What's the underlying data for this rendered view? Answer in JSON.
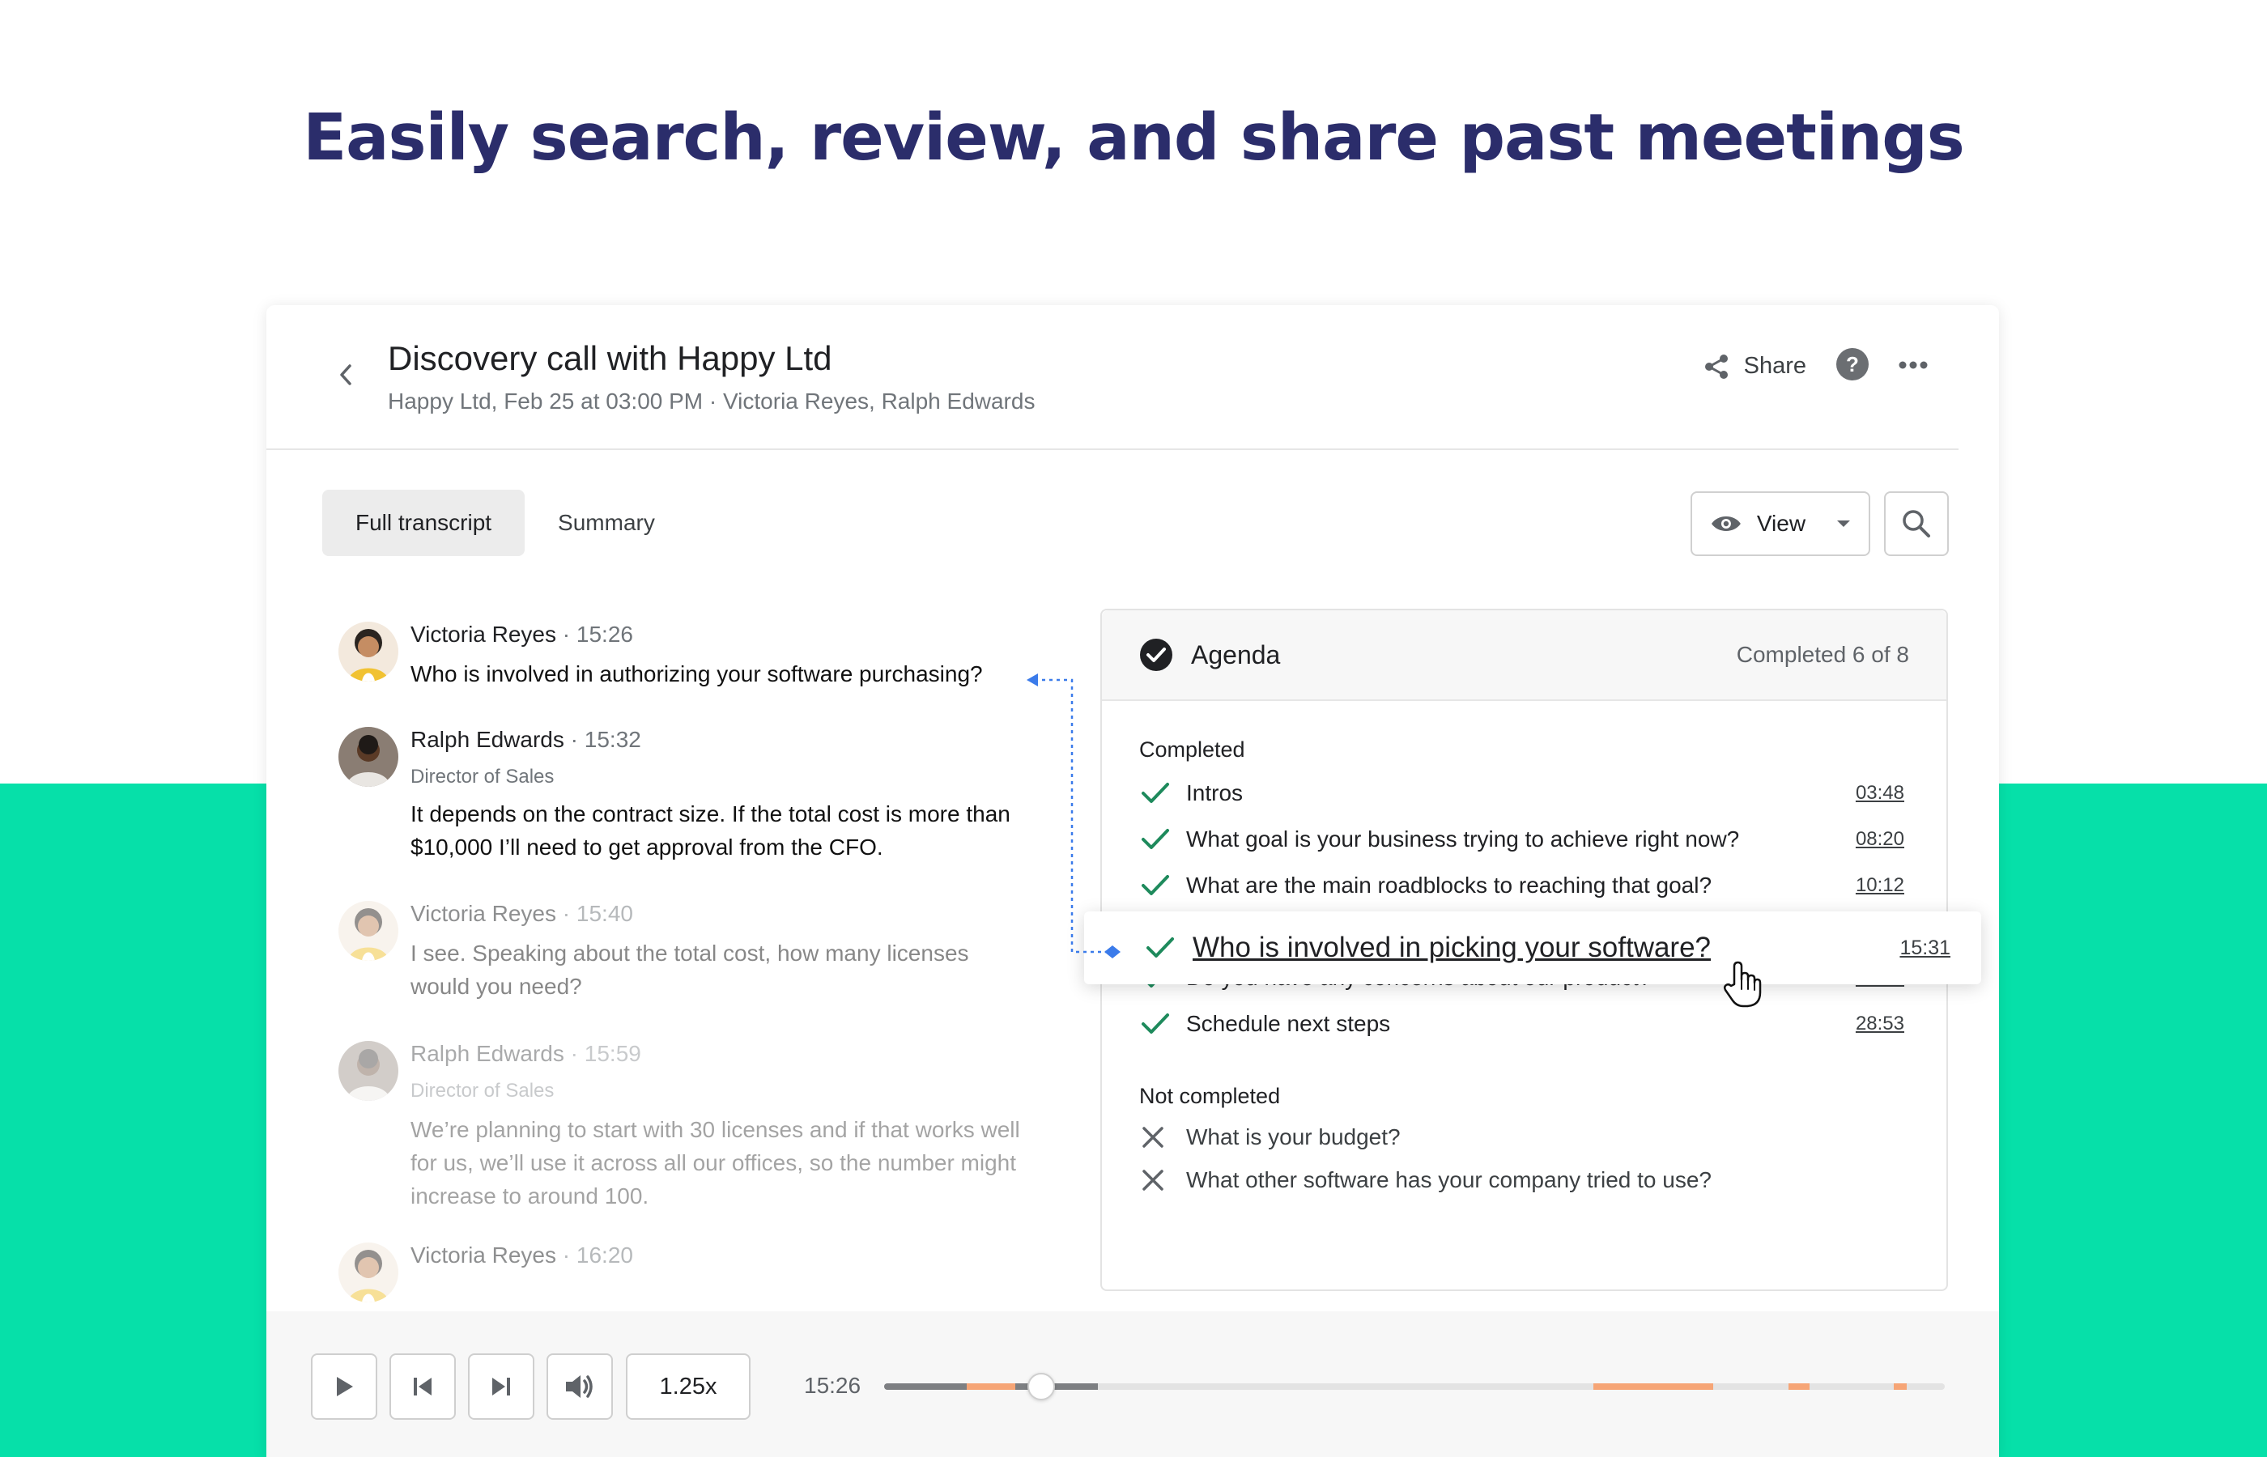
{
  "headline": "Easily search, review, and share past meetings",
  "header": {
    "title": "Discovery call with Happy Ltd",
    "subtitle": "Happy Ltd, Feb 25 at 03:00 PM · Victoria Reyes, Ralph Edwards",
    "share_label": "Share"
  },
  "tabs": [
    {
      "label": "Full transcript",
      "active": true
    },
    {
      "label": "Summary",
      "active": false
    }
  ],
  "toolbar": {
    "view_label": "View"
  },
  "transcript": [
    {
      "speaker": "Victoria Reyes",
      "time": "15:26",
      "role": "",
      "text": "Who is involved in authorizing your software purchasing?"
    },
    {
      "speaker": "Ralph Edwards",
      "time": "15:32",
      "role": "Director of Sales",
      "text": "It depends on the contract size. If the total cost is more than $10,000 I’ll need to get approval from the CFO."
    },
    {
      "speaker": "Victoria Reyes",
      "time": "15:40",
      "role": "",
      "text": "I see. Speaking about the total cost, how many licenses would you need?"
    },
    {
      "speaker": "Ralph Edwards",
      "time": "15:59",
      "role": "Director of Sales",
      "text": "We’re planning to start with 30 licenses and if that works well for us, we’ll use it across all our offices, so the number might increase to around 100."
    },
    {
      "speaker": "Victoria Reyes",
      "time": "16:20",
      "role": "",
      "text": ""
    }
  ],
  "agenda": {
    "title": "Agenda",
    "count": "Completed 6 of 8",
    "completed_heading": "Completed",
    "not_completed_heading": "Not completed",
    "completed": [
      {
        "label": "Intros",
        "time": "03:48"
      },
      {
        "label": "What goal is your business trying to achieve right now?",
        "time": "08:20"
      },
      {
        "label": "What are the main roadblocks to reaching that goal?",
        "time": "10:12"
      },
      {
        "label": "Who is involved in picking your software?",
        "time": "15:31"
      },
      {
        "label": "Do you have any concerns about our product?",
        "time": "28:53"
      },
      {
        "label": "Schedule next steps",
        "time": "28:53"
      }
    ],
    "not_completed": [
      {
        "label": "What is your budget?"
      },
      {
        "label": "What other software has your company tried to use?"
      }
    ]
  },
  "player": {
    "speed": "1.25x",
    "current_time": "15:26",
    "progress_fraction": 0.148
  },
  "colors": {
    "accent_green": "#06e0a9",
    "headline_navy": "#2b2d6b",
    "check_green": "#1e8a5c",
    "marker_orange": "#f6a576",
    "connector_blue": "#3b7bea"
  }
}
